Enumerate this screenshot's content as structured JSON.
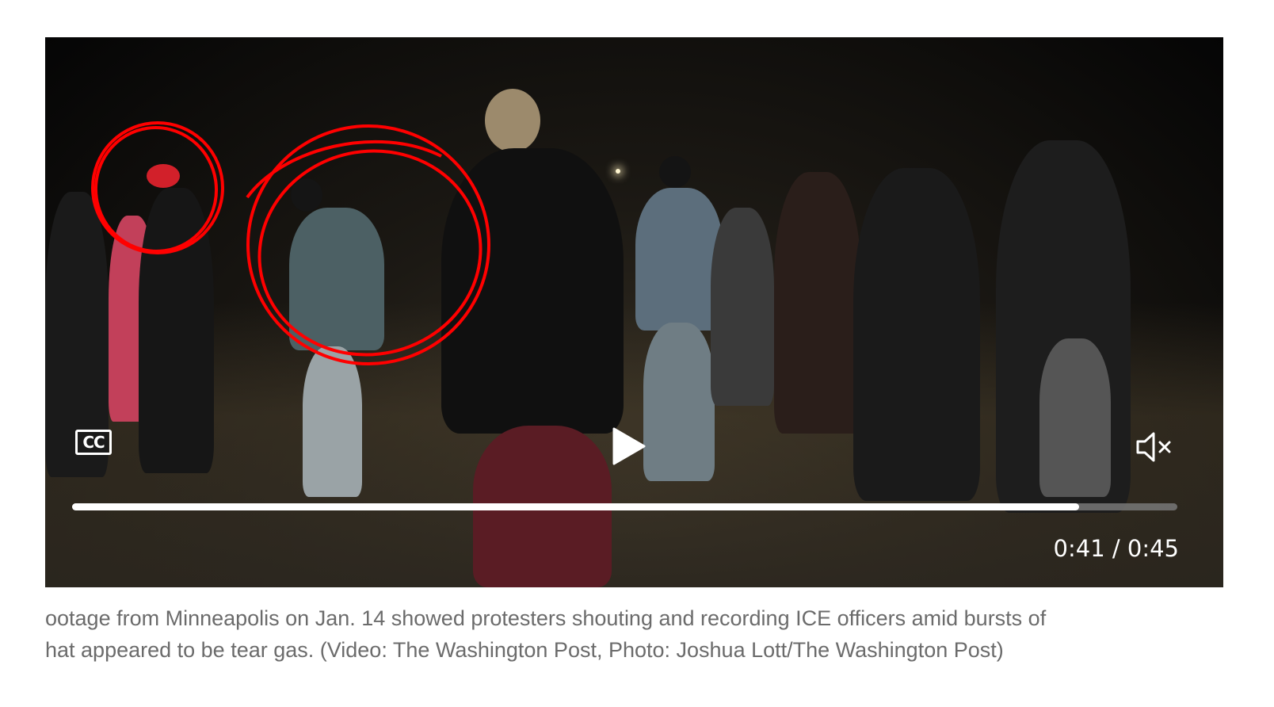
{
  "video": {
    "cc_label": "CC",
    "time_display": "0:41 / 0:45",
    "progress": 0.911
  },
  "caption": {
    "line1": "ootage from Minneapolis on Jan. 14 showed protesters shouting and recording ICE officers amid bursts of",
    "line2": "hat appeared to be tear gas. (Video: The Washington Post, Photo: Joshua Lott/The Washington Post)"
  },
  "colors": {
    "annotation_circle": "#ff0000",
    "caption_text": "#6b6b6b",
    "controls": "#ffffff"
  },
  "icons": [
    "play-icon",
    "mute-icon",
    "closed-captions-icon"
  ]
}
